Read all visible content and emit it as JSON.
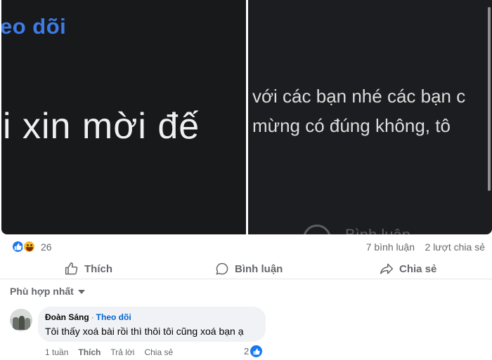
{
  "media": {
    "left_fragment_top": "eo dõi",
    "left_fragment_big": "i xin mời đế",
    "right_caption_line1": "với các bạn nhé các bạn c",
    "right_caption_line2": "mừng có đúng không, tô",
    "right_ghost_text": "Bình luận"
  },
  "summary": {
    "reaction_count": "26",
    "comments": "7 bình luận",
    "shares": "2 lượt chia sẻ",
    "reaction_icons": [
      "like-icon",
      "haha-icon"
    ]
  },
  "actions": {
    "like": "Thích",
    "comment": "Bình luận",
    "share": "Chia sẻ"
  },
  "sort": {
    "label": "Phù hợp nhất"
  },
  "comment": {
    "author": "Đoàn Sáng",
    "separator": "·",
    "follow": "Theo dõi",
    "text": "Tôi thấy xoá bài rồi thì thôi tôi cũng xoá bạn ạ",
    "time": "1 tuần",
    "like": "Thích",
    "reply": "Trả lời",
    "share": "Chia sẻ",
    "reaction_count": "2"
  },
  "colors": {
    "brand_blue": "#1877f2",
    "link_blue": "#0064d1",
    "muted_text": "#65676b",
    "bubble_bg": "#f0f2f5"
  }
}
